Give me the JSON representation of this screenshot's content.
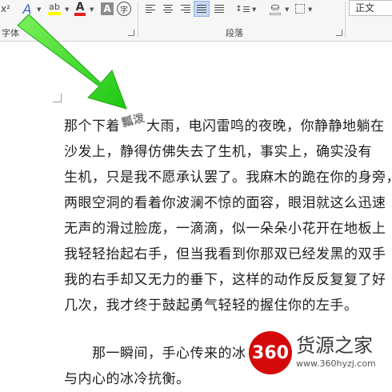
{
  "ribbon": {
    "superscript_label": "x²",
    "font_group_label": "字体",
    "paragraph_group_label": "段落",
    "text_effect_label": "A",
    "highlight_label": "ab",
    "font_color_label": "A",
    "char_shading_label": "A",
    "enclose_char_label": "字",
    "style_box": "正文",
    "highlight_color": "#ffff00",
    "font_color": "#e02020"
  },
  "document": {
    "lines": [
      {
        "before": "那个下着",
        "wordart": "瓢泼",
        "after": "大雨，电闪雷鸣的夜晚，你静静地躺在"
      },
      {
        "text": "沙发上，静得仿佛失去了生机，事实上，确实没有"
      },
      {
        "text": "生机，只是我不愿承认罢了。我麻木的跪在你的身旁，"
      },
      {
        "text": "两眼空洞的看着你波澜不惊的面容，眼泪就这么迅速"
      },
      {
        "text": "无声的滑过脸庞，一滴滴，似一朵朵小花开在地板上"
      },
      {
        "text": "我轻轻抬起右手，但当我看到你那双已经发黑的双手"
      },
      {
        "text": "我的右手却又无力的垂下，这样的动作反反复复了好"
      },
      {
        "text": "几次，我才终于鼓起勇气轻轻的握住你的左手。"
      },
      {
        "text": "　　那一瞬间，手心传来的冰冷"
      },
      {
        "text": "与内心的冰冷抗衡。"
      }
    ]
  },
  "annotation": {
    "arrow_color": "#33dd1a"
  },
  "watermark": {
    "logo_text": "360",
    "site_name": "货源之家",
    "url": "www.360hyzj.com"
  }
}
